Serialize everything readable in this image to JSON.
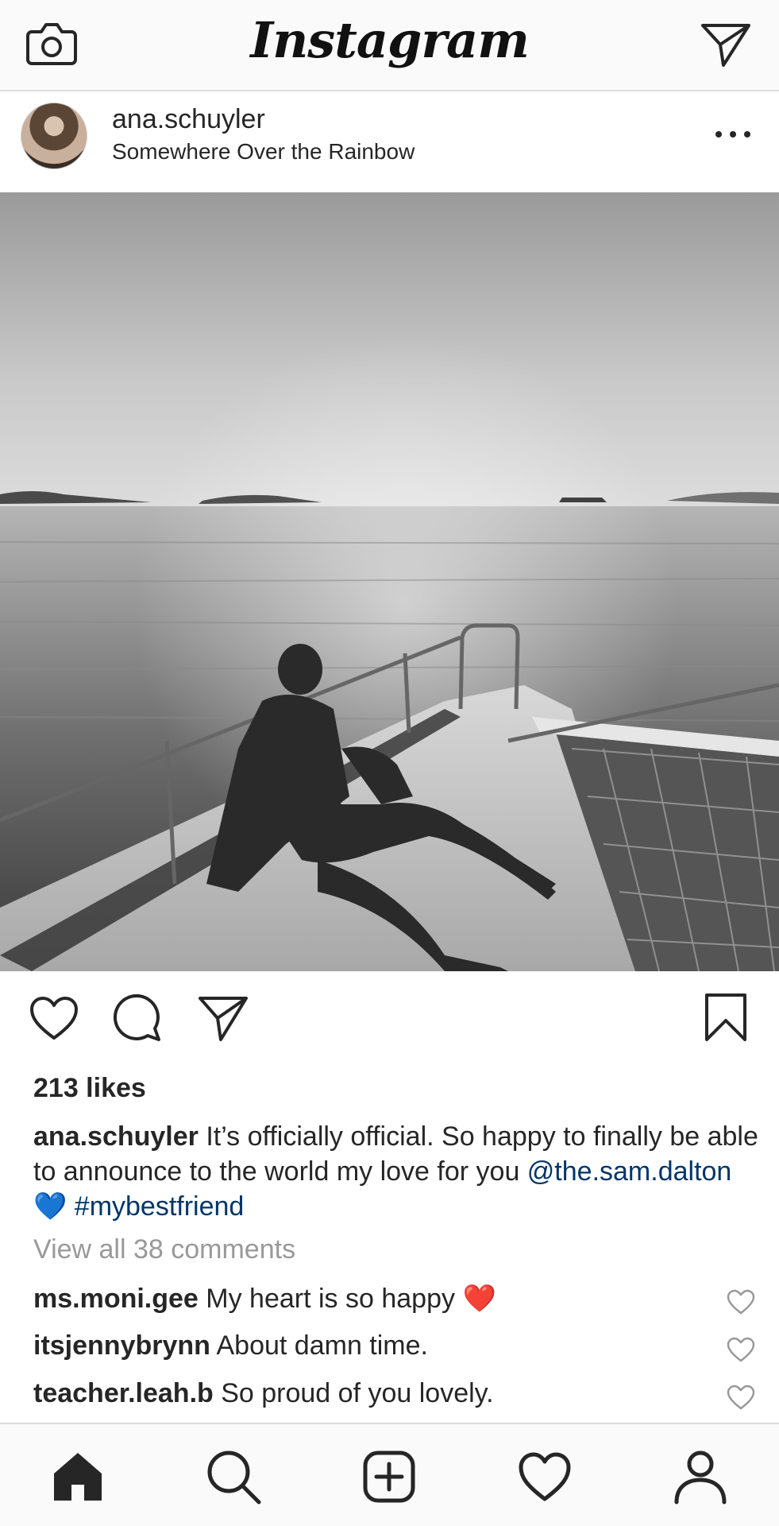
{
  "app": {
    "logo_text": "Instagram"
  },
  "post": {
    "username": "ana.schuyler",
    "location": "Somewhere Over the Rainbow",
    "likes": "213 likes",
    "caption": {
      "username": "ana.schuyler",
      "text": " It’s officially official. So happy to finally be able to announce to the world my love for you ",
      "mention": "@the.sam.dalton",
      "emoji": " 💙 ",
      "hashtag": "#mybestfriend"
    },
    "view_all": "View all 38 comments",
    "comments": [
      {
        "username": "ms.moni.gee",
        "text": " My heart is so happy ",
        "emoji": "❤️"
      },
      {
        "username": "itsjennybrynn",
        "text": " About damn time.",
        "emoji": ""
      },
      {
        "username": "teacher.leah.b",
        "text": " So proud of you lovely.",
        "emoji": ""
      }
    ]
  },
  "icons": {
    "camera": "camera-icon",
    "direct": "paper-plane-icon",
    "more": "more-dots-icon",
    "like": "heart-icon",
    "comment": "comment-bubble-icon",
    "share": "paper-plane-icon",
    "save": "bookmark-icon",
    "nav": [
      "home-icon",
      "search-icon",
      "add-post-icon",
      "activity-heart-icon",
      "profile-icon"
    ]
  },
  "colors": {
    "link": "#003569",
    "muted": "#999999",
    "text": "#262626",
    "heart_emoji": "#d0191f",
    "blue_heart_emoji": "#2e7be0"
  }
}
